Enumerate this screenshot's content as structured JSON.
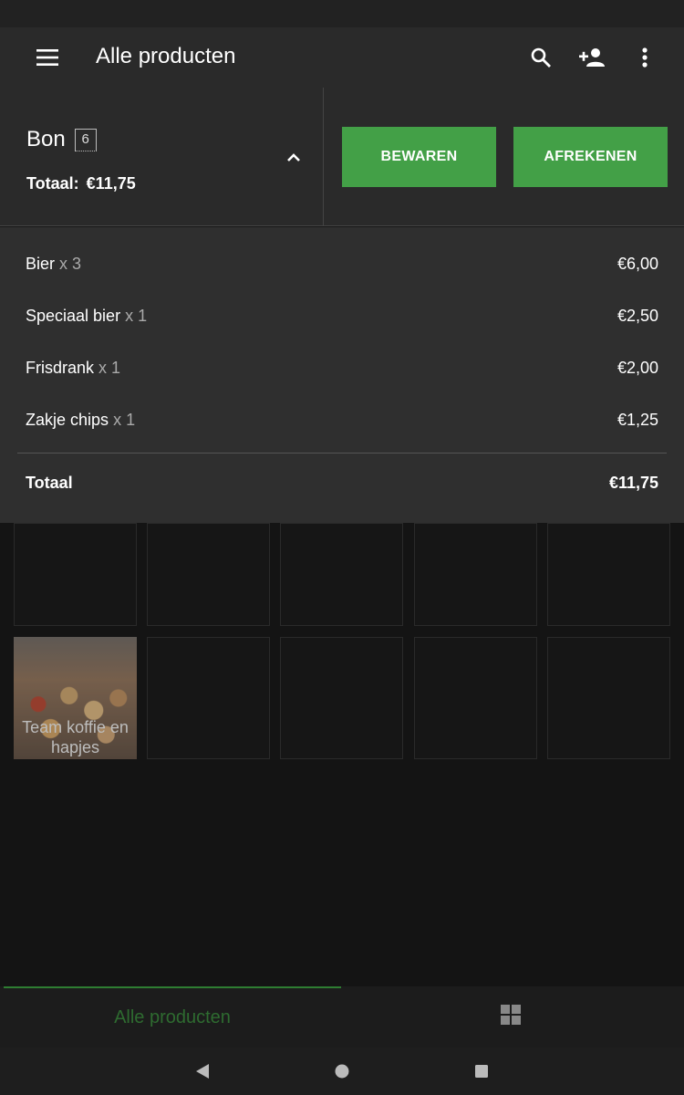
{
  "app_bar": {
    "title": "Alle producten",
    "icons": [
      "menu-icon",
      "search-icon",
      "add-person-icon",
      "more-vert-icon"
    ]
  },
  "receipt": {
    "title": "Bon",
    "count": "6",
    "total_label": "Totaal:",
    "total_value": "€11,75",
    "save_label": "BEWAREN",
    "pay_label": "AFREKENEN"
  },
  "lines": [
    {
      "name": "Bier",
      "qty": "x 3",
      "price": "€6,00"
    },
    {
      "name": "Speciaal bier",
      "qty": "x 1",
      "price": "€2,50"
    },
    {
      "name": "Frisdrank",
      "qty": "x 1",
      "price": "€2,00"
    },
    {
      "name": "Zakje chips",
      "qty": "x 1",
      "price": "€1,25"
    }
  ],
  "lines_total": {
    "label": "Totaal",
    "value": "€11,75"
  },
  "products": [
    {
      "label": "Team koffie en hapjes"
    }
  ],
  "tabs": {
    "active": "Alle producten",
    "icons": [
      "grid-icon"
    ]
  },
  "colors": {
    "accent": "#43a047",
    "background": "#161616",
    "surface": "#2a2a2a"
  }
}
